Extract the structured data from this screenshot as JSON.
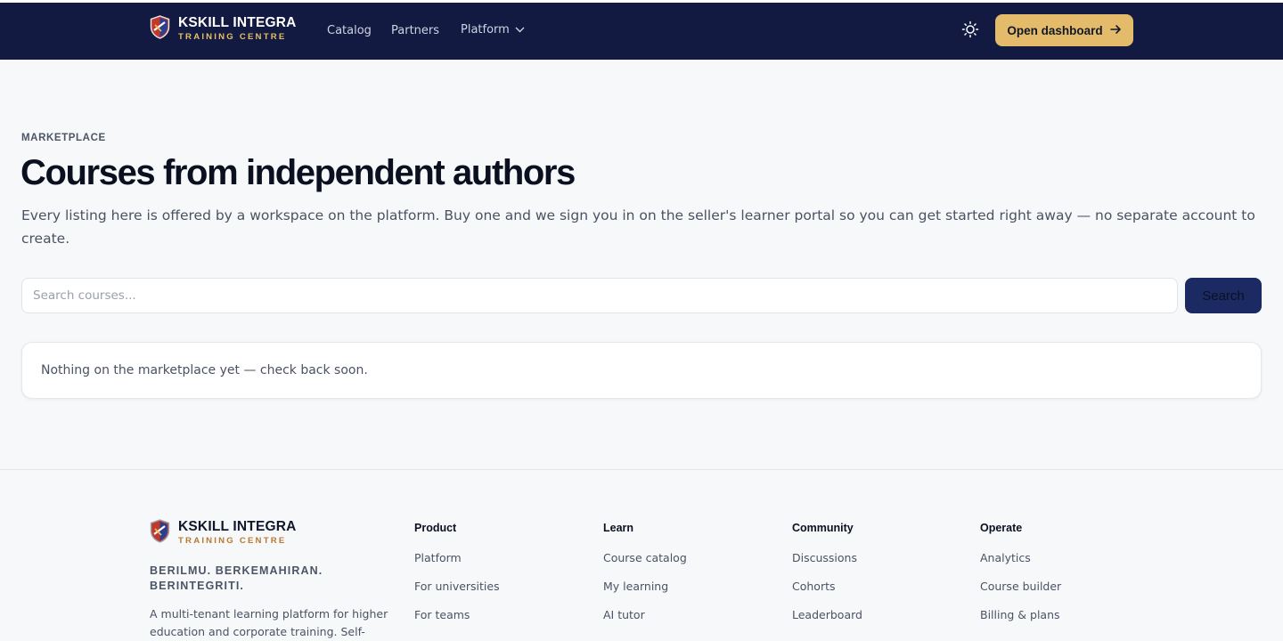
{
  "header": {
    "brand_name": "KSKILL INTEGRA",
    "brand_sub": "TRAINING CENTRE",
    "nav": {
      "catalog": "Catalog",
      "partners": "Partners",
      "platform": "Platform"
    },
    "dashboard_button": "Open dashboard"
  },
  "main": {
    "eyebrow": "MARKETPLACE",
    "title": "Courses from independent authors",
    "lead": "Every listing here is offered by a workspace on the platform. Buy one and we sign you in on the seller's learner portal so you can get started right away — no separate account to create.",
    "search": {
      "placeholder": "Search courses...",
      "button": "Search"
    },
    "empty_message": "Nothing on the marketplace yet — check back soon."
  },
  "footer": {
    "brand_name": "KSKILL INTEGRA",
    "brand_sub": "TRAINING CENTRE",
    "tagline": "BERILMU. BERKEMAHIRAN. BERINTEGRITI.",
    "description": "A multi-tenant learning platform for higher education and corporate training. Self-",
    "columns": [
      {
        "heading": "Product",
        "links": [
          "Platform",
          "For universities",
          "For teams"
        ]
      },
      {
        "heading": "Learn",
        "links": [
          "Course catalog",
          "My learning",
          "AI tutor"
        ]
      },
      {
        "heading": "Community",
        "links": [
          "Discussions",
          "Cohorts",
          "Leaderboard"
        ]
      },
      {
        "heading": "Operate",
        "links": [
          "Analytics",
          "Course builder",
          "Billing & plans"
        ]
      }
    ]
  },
  "colors": {
    "navbar": "#121a42",
    "accent_gold": "#e3bb6b",
    "search_button": "#1c2a63",
    "background": "#f7f8fa"
  },
  "icons": [
    "shield-logo-icon",
    "chevron-down-icon",
    "sun-icon",
    "arrow-right-icon"
  ]
}
